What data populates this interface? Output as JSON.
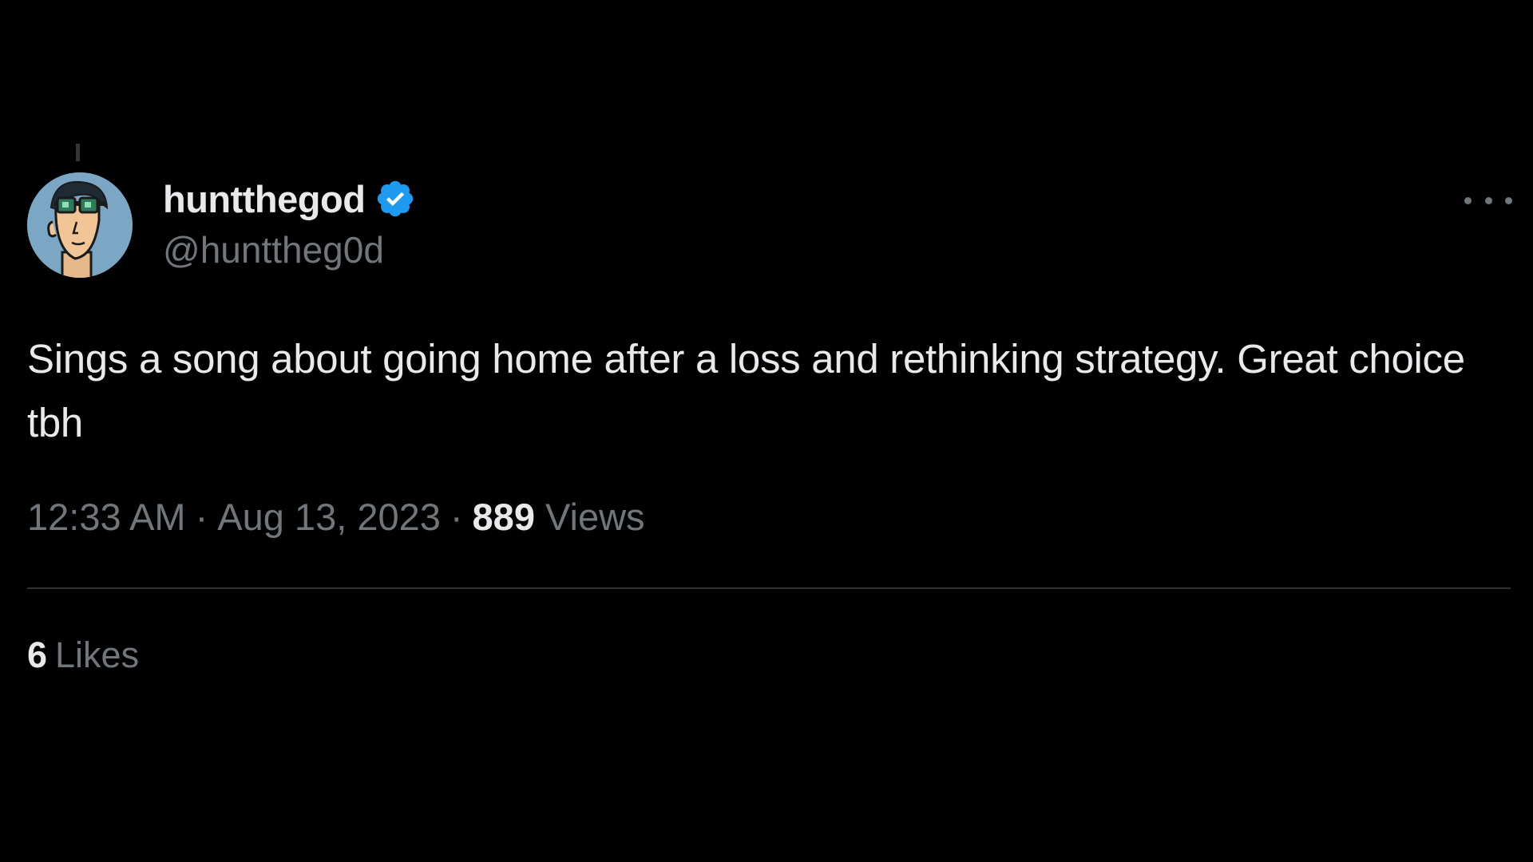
{
  "tweet": {
    "author": {
      "display_name": "huntthegod",
      "handle": "@hunttheg0d",
      "verified": true,
      "verified_color": "#1d9bf0",
      "avatar_icon": "avatar-illustration"
    },
    "text": "Sings a song about going home after a loss and rethinking strategy. Great choice tbh",
    "time": "12:33 AM",
    "date": "Aug 13, 2023",
    "separator": "·",
    "views_count": "889",
    "views_label": "Views",
    "likes_count": "6",
    "likes_label": "Likes",
    "more_icon": "more-options-icon"
  },
  "colors": {
    "background": "#000000",
    "primary_text": "#e7e9ea",
    "secondary_text": "#71767b",
    "divider": "#2f3336"
  }
}
